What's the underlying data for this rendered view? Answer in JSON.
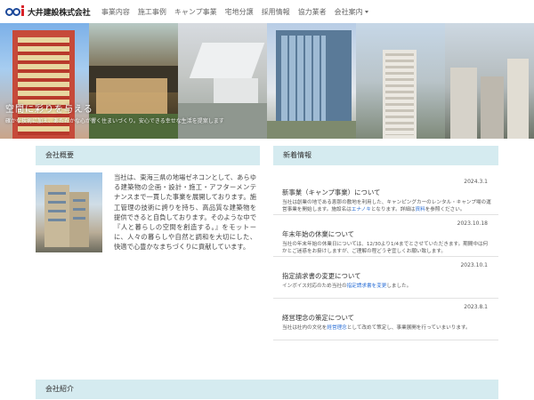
{
  "brand": {
    "name": "大井建設株式会社",
    "logo_text": "ooi"
  },
  "nav": {
    "items": [
      "事業内容",
      "施工事例",
      "キャンプ事業",
      "宅地分譲",
      "採用情報",
      "協力業者"
    ],
    "dropdown_label": "会社案内"
  },
  "hero": {
    "title": "空間に彩りを与える",
    "subtitle": "確かな技術に加え、あたたかな心が響く住まいづくり。安心できる幸せな生活を提案します"
  },
  "about": {
    "heading": "会社概要",
    "text": "当社は、東海三県の地場ゼネコンとして、あらゆる建築物の企画・設計・施工・アフターメンテナンスまで一貫した事業を展開しております。施工管理の技術に誇りを持ち、高品質な建築物を提供できると自負しております。そのような中で『人と暮らしの空間を創造する。』をモットーに、人々の暮らしや自然と調和を大切にした、快適で心豊かなまちづくりに貢献しています。"
  },
  "news": {
    "heading": "新着情報",
    "items": [
      {
        "date": "2024.3.1",
        "title": "新事業（キャンプ事業）について",
        "body_pre": "当社は創業の地である恵那の敷地を利用した、キャンピングカーのレンタル・キャンプ場の運営事業を開始します。施設名は",
        "link1": "エナノキ",
        "body_mid": "となります。詳細は",
        "link2": "資料",
        "body_post": "を参照ください。"
      },
      {
        "date": "2023.10.18",
        "title": "年末年始の休業について",
        "body": "当社の年末年始の休業日については、12/30より1/4までとさせていただきます。期間中は何かとご迷惑をお掛けしますが、ご理解の程どうぞ宜しくお願い致します。"
      },
      {
        "date": "2023.10.1",
        "title": "指定請求書の変更について",
        "body_pre": "インボイス対応のため当社の",
        "link1": "指定請求書を変更",
        "body_post": "しました。"
      },
      {
        "date": "2023.8.1",
        "title": "経営理念の策定について",
        "body_pre": "当社は社内の文化を",
        "link1": "経営理念",
        "body_post": "として改めて策定し、事業展開を行っていまいります。"
      }
    ]
  },
  "intro": {
    "heading": "会社紹介"
  }
}
